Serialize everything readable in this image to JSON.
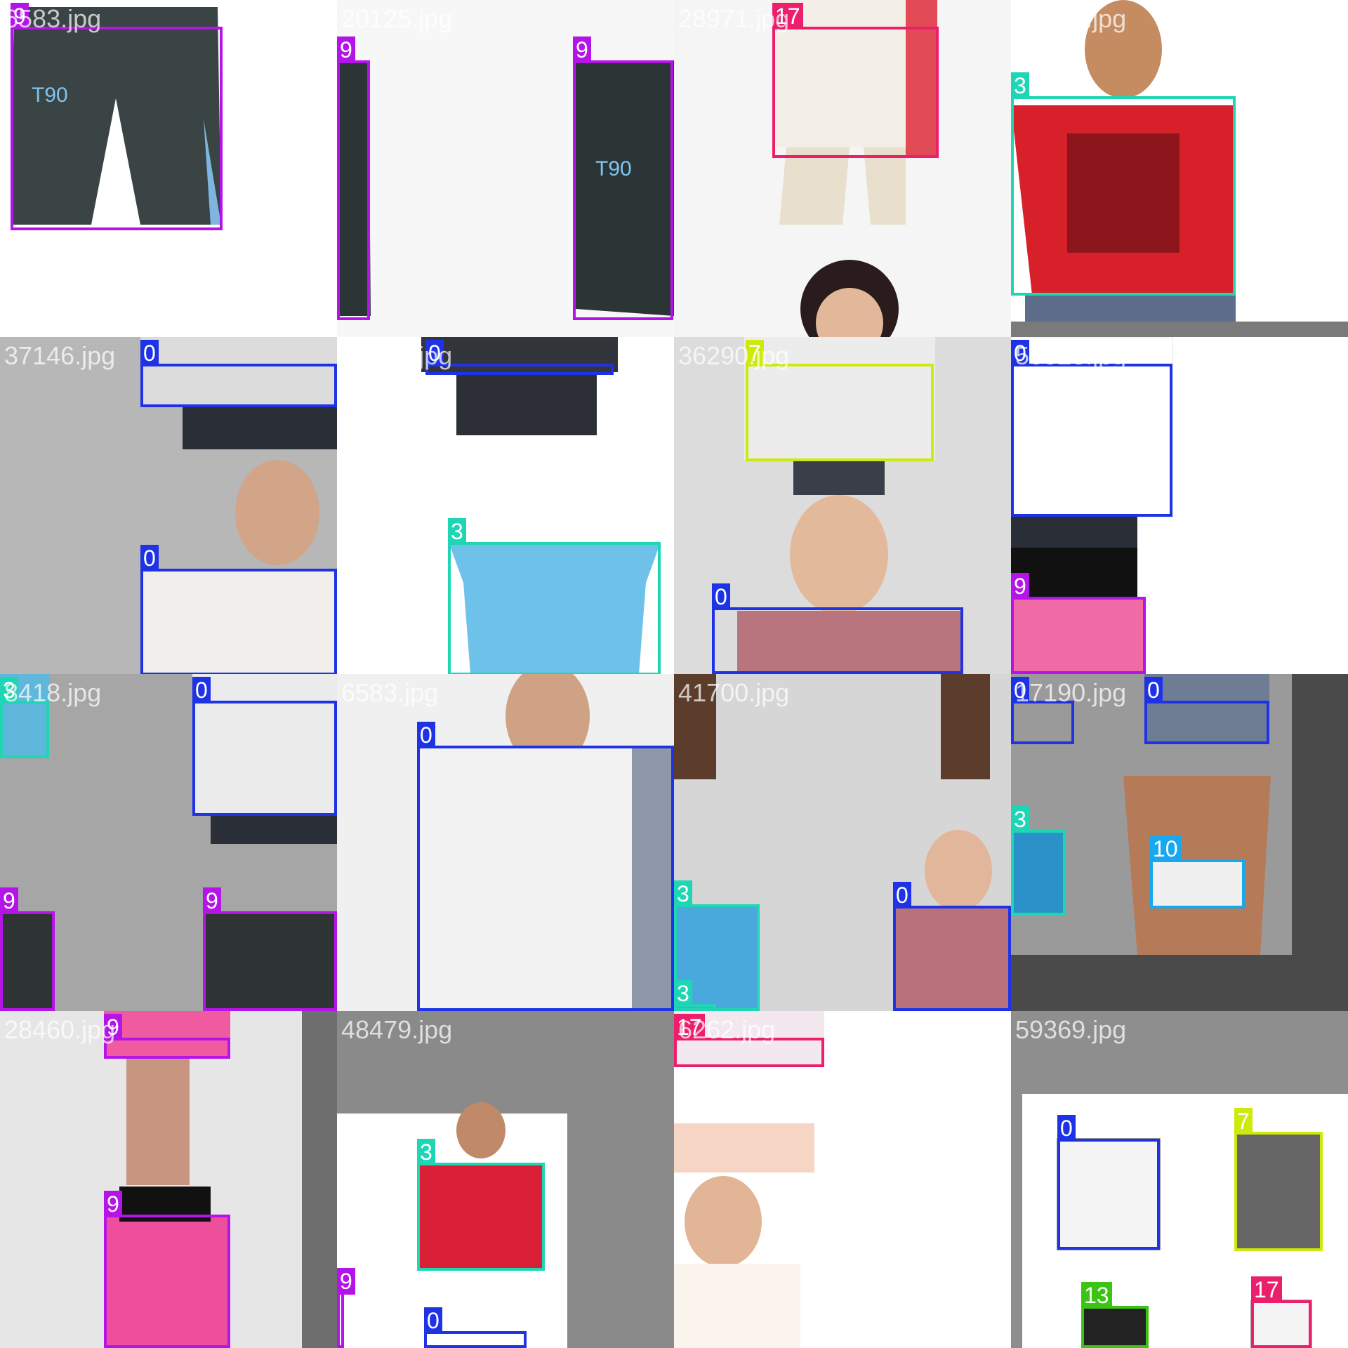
{
  "tiles": [
    {
      "file": "6583.jpg",
      "bg": "#ffffff",
      "boxes": [
        {
          "cls": "9"
        }
      ]
    },
    {
      "file": "20125.jpg",
      "bg": "#f7f7f7",
      "boxes": [
        {
          "cls": "9"
        },
        {
          "cls": "9"
        }
      ]
    },
    {
      "file": "28971.jpg",
      "bg": "#f5f5f5",
      "boxes": [
        {
          "cls": "17"
        }
      ]
    },
    {
      "file": "27501.jpg",
      "bg": "#ffffff",
      "boxes": [
        {
          "cls": "3"
        }
      ]
    },
    {
      "file": "37146.jpg",
      "bg": "#b7b7b7",
      "boxes": [
        {
          "cls": "0"
        },
        {
          "cls": "0"
        }
      ]
    },
    {
      "file": "15976.jpg",
      "bg": "#ffffff",
      "boxes": [
        {
          "cls": "0"
        },
        {
          "cls": "3"
        }
      ]
    },
    {
      "file": "36290.jpg",
      "bg": "#dcdcdc",
      "boxes": [
        {
          "cls": "7"
        },
        {
          "cls": "0"
        }
      ]
    },
    {
      "file": "50528.jpg",
      "bg": "#ffffff",
      "boxes": [
        {
          "cls": "0"
        },
        {
          "cls": "9"
        }
      ]
    },
    {
      "file": "8418.jpg",
      "bg": "#a6a6a6",
      "boxes": [
        {
          "cls": "3"
        },
        {
          "cls": "0"
        },
        {
          "cls": "9"
        },
        {
          "cls": "9"
        }
      ]
    },
    {
      "file": "6583.jpg",
      "bg": "#f0f0f0",
      "boxes": [
        {
          "cls": "0"
        }
      ]
    },
    {
      "file": "41700.jpg",
      "bg": "#d6d6d6",
      "boxes": [
        {
          "cls": "3"
        },
        {
          "cls": "0"
        },
        {
          "cls": "3"
        }
      ]
    },
    {
      "file": "17190.jpg",
      "bg": "#9a9a9a",
      "boxes": [
        {
          "cls": "0"
        },
        {
          "cls": "0"
        },
        {
          "cls": "3"
        },
        {
          "cls": "10"
        }
      ]
    },
    {
      "file": "28460.jpg",
      "bg": "#e6e6e6",
      "boxes": [
        {
          "cls": "9"
        },
        {
          "cls": "9"
        }
      ]
    },
    {
      "file": "48479.jpg",
      "bg": "#8a8a8a",
      "boxes": [
        {
          "cls": "3"
        },
        {
          "cls": "0"
        },
        {
          "cls": "9"
        }
      ]
    },
    {
      "file": "6262.jpg",
      "bg": "#ffffff",
      "boxes": [
        {
          "cls": "17"
        }
      ]
    },
    {
      "file": "59369.jpg",
      "bg": "#8e8e8e",
      "boxes": [
        {
          "cls": "0"
        },
        {
          "cls": "7"
        },
        {
          "cls": "13"
        },
        {
          "cls": "17"
        }
      ]
    }
  ],
  "class_colors": {
    "0": "#1f33e6",
    "3": "#1fd6b4",
    "7": "#cdea0c",
    "9": "#b414e8",
    "10": "#18a8f0",
    "13": "#3cc414",
    "17": "#ec1f6c"
  }
}
